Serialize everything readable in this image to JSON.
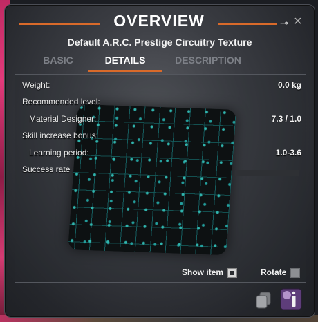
{
  "window": {
    "title": "OVERVIEW",
    "subtitle": "Default A.R.C. Prestige Circuitry Texture",
    "pin_icon": "pin-icon",
    "close_icon": "close-icon",
    "close_glyph": "×",
    "pin_glyph": "⊸"
  },
  "tabs": [
    {
      "label": "BASIC",
      "active": false
    },
    {
      "label": "DETAILS",
      "active": true
    },
    {
      "label": "DESCRIPTION",
      "active": false
    }
  ],
  "details": {
    "weight_label": "Weight:",
    "weight_value": "0.0 kg",
    "recommended_level_label": "Recommended level:",
    "material_designer_label": "Material Designer:",
    "material_designer_value": "7.3 / 1.0",
    "skill_increase_label": "Skill increase bonus:",
    "learning_period_label": "Learning period:",
    "learning_period_value": "1.0-3.6",
    "success_rate_label": "Success rate"
  },
  "controls": {
    "show_item_label": "Show item",
    "show_item_checked": true,
    "rotate_label": "Rotate",
    "rotate_checked": false
  },
  "colors": {
    "accent": "#d96a2a",
    "texture_glow": "#33e3d8"
  },
  "icons": {
    "copy": "copy-icon",
    "info": "info-icon"
  }
}
